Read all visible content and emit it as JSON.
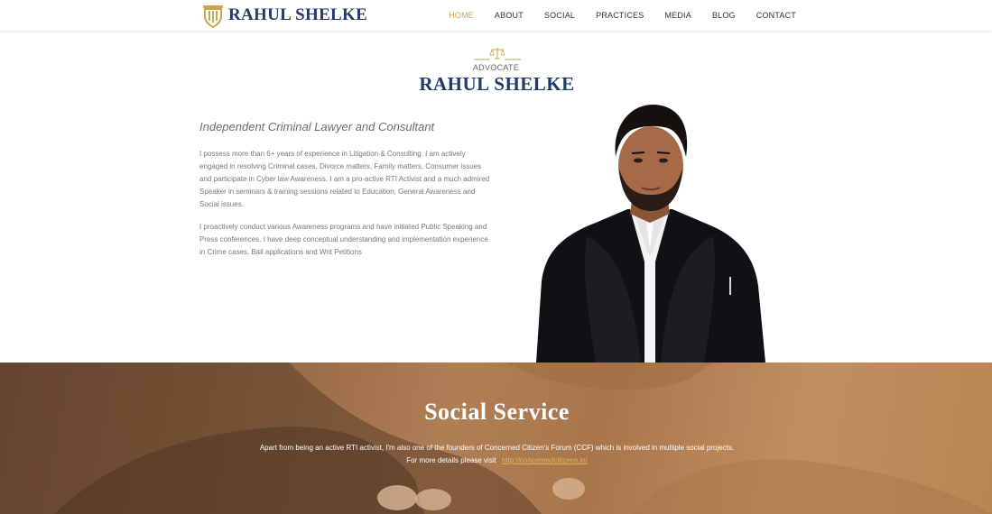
{
  "header": {
    "logo_text": "RAHUL SHELKE",
    "logo_icon": "pillar-shield-icon",
    "nav": [
      {
        "label": "HOME",
        "active": true
      },
      {
        "label": "ABOUT"
      },
      {
        "label": "SOCIAL"
      },
      {
        "label": "PRACTICES"
      },
      {
        "label": "MEDIA"
      },
      {
        "label": "BLOG"
      },
      {
        "label": "CONTACT"
      }
    ]
  },
  "hero": {
    "eyebrow": "ADVOCATE",
    "title": "RAHUL SHELKE",
    "tagline": "Independent Criminal Lawyer and Consultant",
    "paragraphs": [
      "I possess more than 6+ years of experience in Litigation & Consulting. I am actively engaged in resolving Criminal cases, Divorce matters, Family matters, Consumer issues and participate in Cyber law Awareness. I am a pro-active RTI Activist and a much admired Speaker in seminars & training sessions related to Education, General Awareness and Social issues.",
      "I proactively conduct various Awareness programs and have initiated Public Speaking and Press conferences. I have deep conceptual understanding and implementation experience in Crime cases, Bail applications and Writ Petitions"
    ]
  },
  "social": {
    "title": "Social Service",
    "line1": "Apart from being an active RTI activist, I'm also one of the founders of Concerned Citizen's Forum (CCF) which is involved in multiple social projects.",
    "line2_prefix": "For more details please visit",
    "link": "http://concernedcitizens.in/"
  },
  "colors": {
    "brand_navy": "#1f3a6b",
    "accent_gold": "#c9a54b"
  }
}
